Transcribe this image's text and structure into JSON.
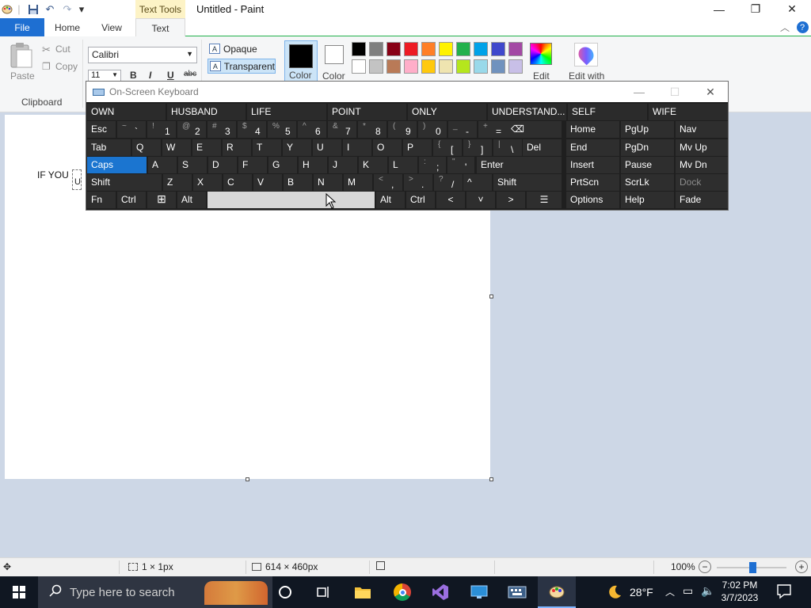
{
  "window": {
    "title": "Untitled - Paint",
    "context_tab": "Text Tools",
    "controls": {
      "minimize": "—",
      "restore": "❐",
      "close": "✕"
    }
  },
  "quick_access": {
    "undo": "↶",
    "redo": "↷",
    "customize": "▾"
  },
  "ribbon": {
    "tabs": {
      "file": "File",
      "home": "Home",
      "view": "View",
      "text": "Text"
    },
    "clipboard": {
      "paste": "Paste",
      "cut": "Cut",
      "copy": "Copy",
      "group": "Clipboard"
    },
    "font": {
      "family": "Calibri",
      "size": "11",
      "bold": "B",
      "italic": "I",
      "underline": "U",
      "strike": "abc"
    },
    "background": {
      "opaque": "Opaque",
      "transparent": "Transparent"
    },
    "colors": {
      "color1": "Color",
      "color2": "Color",
      "edit_colors": "Edit",
      "edit_with": "Edit with",
      "palette": [
        "#000000",
        "#7f7f7f",
        "#880015",
        "#ed1c24",
        "#ff7f27",
        "#fff200",
        "#22b14c",
        "#00a2e8",
        "#3f48cc",
        "#a349a4",
        "#ffffff",
        "#c3c3c3",
        "#b97a57",
        "#ffaec9",
        "#ffc90e",
        "#efe4b0",
        "#b5e61d",
        "#99d9ea",
        "#7092be",
        "#c8bfe7"
      ]
    },
    "help": "?",
    "collapse": "︿"
  },
  "canvas": {
    "text": "IF YOU",
    "text_fragment": "UN"
  },
  "osk": {
    "title": "On-Screen Keyboard",
    "controls": {
      "minimize": "—",
      "maximize": "☐",
      "close": "✕"
    },
    "predictions": [
      "OWN",
      "HUSBAND",
      "LIFE",
      "POINT",
      "ONLY",
      "UNDERSTAND...",
      "SELF",
      "WIFE"
    ],
    "row1": {
      "esc": "Esc",
      "keys": [
        {
          "shift": "~",
          "main": "`"
        },
        {
          "shift": "!",
          "main": "1"
        },
        {
          "shift": "@",
          "main": "2"
        },
        {
          "shift": "#",
          "main": "3"
        },
        {
          "shift": "$",
          "main": "4"
        },
        {
          "shift": "%",
          "main": "5"
        },
        {
          "shift": "^",
          "main": "6"
        },
        {
          "shift": "&",
          "main": "7"
        },
        {
          "shift": "*",
          "main": "8"
        },
        {
          "shift": "(",
          "main": "9"
        },
        {
          "shift": ")",
          "main": "0"
        },
        {
          "shift": "_",
          "main": "-"
        },
        {
          "shift": "+",
          "main": "="
        }
      ],
      "backspace": "⌫"
    },
    "row2": {
      "tab": "Tab",
      "letters": [
        "Q",
        "W",
        "E",
        "R",
        "T",
        "Y",
        "U",
        "I",
        "O",
        "P"
      ],
      "symbols": [
        {
          "shift": "{",
          "main": "["
        },
        {
          "shift": "}",
          "main": "]"
        },
        {
          "shift": "|",
          "main": "\\"
        }
      ],
      "del": "Del"
    },
    "row3": {
      "caps": "Caps",
      "letters": [
        "A",
        "S",
        "D",
        "F",
        "G",
        "H",
        "J",
        "K",
        "L"
      ],
      "symbols": [
        {
          "shift": ":",
          "main": ";"
        },
        {
          "shift": "\"",
          "main": "'"
        }
      ],
      "enter": "Enter"
    },
    "row4": {
      "shift_left": "Shift",
      "letters": [
        "Z",
        "X",
        "C",
        "V",
        "B",
        "N",
        "M"
      ],
      "symbols": [
        {
          "shift": "<",
          "main": ","
        },
        {
          "shift": ">",
          "main": "."
        },
        {
          "shift": "?",
          "main": "/"
        }
      ],
      "up": "^",
      "shift_right": "Shift"
    },
    "row5": {
      "fn": "Fn",
      "ctrl_left": "Ctrl",
      "win": "⊞",
      "alt_left": "Alt",
      "alt_right": "Alt",
      "ctrl_right": "Ctrl",
      "left": "<",
      "down": "˅",
      "right": ">",
      "menu": "☰"
    },
    "nav": {
      "home": "Home",
      "pgup": "PgUp",
      "navkey": "Nav",
      "end": "End",
      "pgdn": "PgDn",
      "mvup": "Mv Up",
      "insert": "Insert",
      "pause": "Pause",
      "mvdn": "Mv Dn",
      "prtscn": "PrtScn",
      "scrlk": "ScrLk",
      "dock": "Dock",
      "options": "Options",
      "help": "Help",
      "fade": "Fade"
    }
  },
  "statusbar": {
    "selection_size": "1 × 1px",
    "canvas_size": "614 × 460px",
    "zoom": "100%",
    "zoom_out": "−",
    "zoom_in": "+"
  },
  "taskbar": {
    "search_placeholder": "Type here to search",
    "weather": "28°F",
    "time": "7:02 PM",
    "date": "3/7/2023"
  }
}
